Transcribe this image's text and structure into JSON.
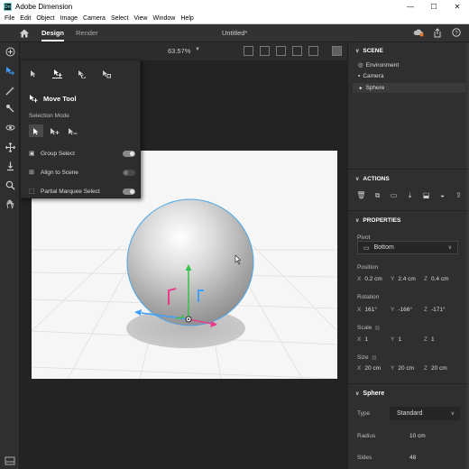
{
  "window": {
    "title": "Adobe Dimension",
    "icon_text": "Dn",
    "controls": [
      "minimize-icon",
      "maximize-icon",
      "close-icon"
    ]
  },
  "menu": [
    "File",
    "Edit",
    "Object",
    "Image",
    "Camera",
    "Select",
    "View",
    "Window",
    "Help"
  ],
  "appbar": {
    "tabs": [
      "Design",
      "Render"
    ],
    "active_tab": "Design",
    "document_title": "Untitled*"
  },
  "viewport": {
    "zoom": "63.57%"
  },
  "tool_panel": {
    "tool_name": "Move Tool",
    "selection_mode_label": "Selection Mode",
    "options": [
      {
        "label": "Group Select",
        "state": "on"
      },
      {
        "label": "Align to Scene",
        "state": "off"
      },
      {
        "label": "Partial Marquee Select",
        "state": "on"
      }
    ]
  },
  "scene": {
    "header": "SCENE",
    "items": [
      "Environment",
      "Camera",
      "Sphere"
    ],
    "selected": "Sphere"
  },
  "actions": {
    "header": "ACTIONS"
  },
  "properties": {
    "header": "PROPERTIES",
    "pivot_label": "Pivot",
    "pivot_value": "Bottom",
    "position_label": "Position",
    "position": {
      "x": "0.2 cm",
      "y": "2.4 cm",
      "z": "0.4 cm"
    },
    "rotation_label": "Rotation",
    "rotation": {
      "x": "161°",
      "y": "-166°",
      "z": "-171°"
    },
    "scale_label": "Scale",
    "scale": {
      "x": "1",
      "y": "1",
      "z": "1"
    },
    "size_label": "Size",
    "size": {
      "x": "20 cm",
      "y": "20 cm",
      "z": "20 cm"
    }
  },
  "sphere": {
    "header": "Sphere",
    "type_label": "Type",
    "type_value": "Standard",
    "radius_label": "Radius",
    "radius_value": "10 cm",
    "sides_label": "Sides",
    "sides_value": "48"
  },
  "colors": {
    "accent": "#3c9bff",
    "gizmo_x": "#3ca0ff",
    "gizmo_y": "#36c24a",
    "gizmo_z": "#e83c8c"
  }
}
